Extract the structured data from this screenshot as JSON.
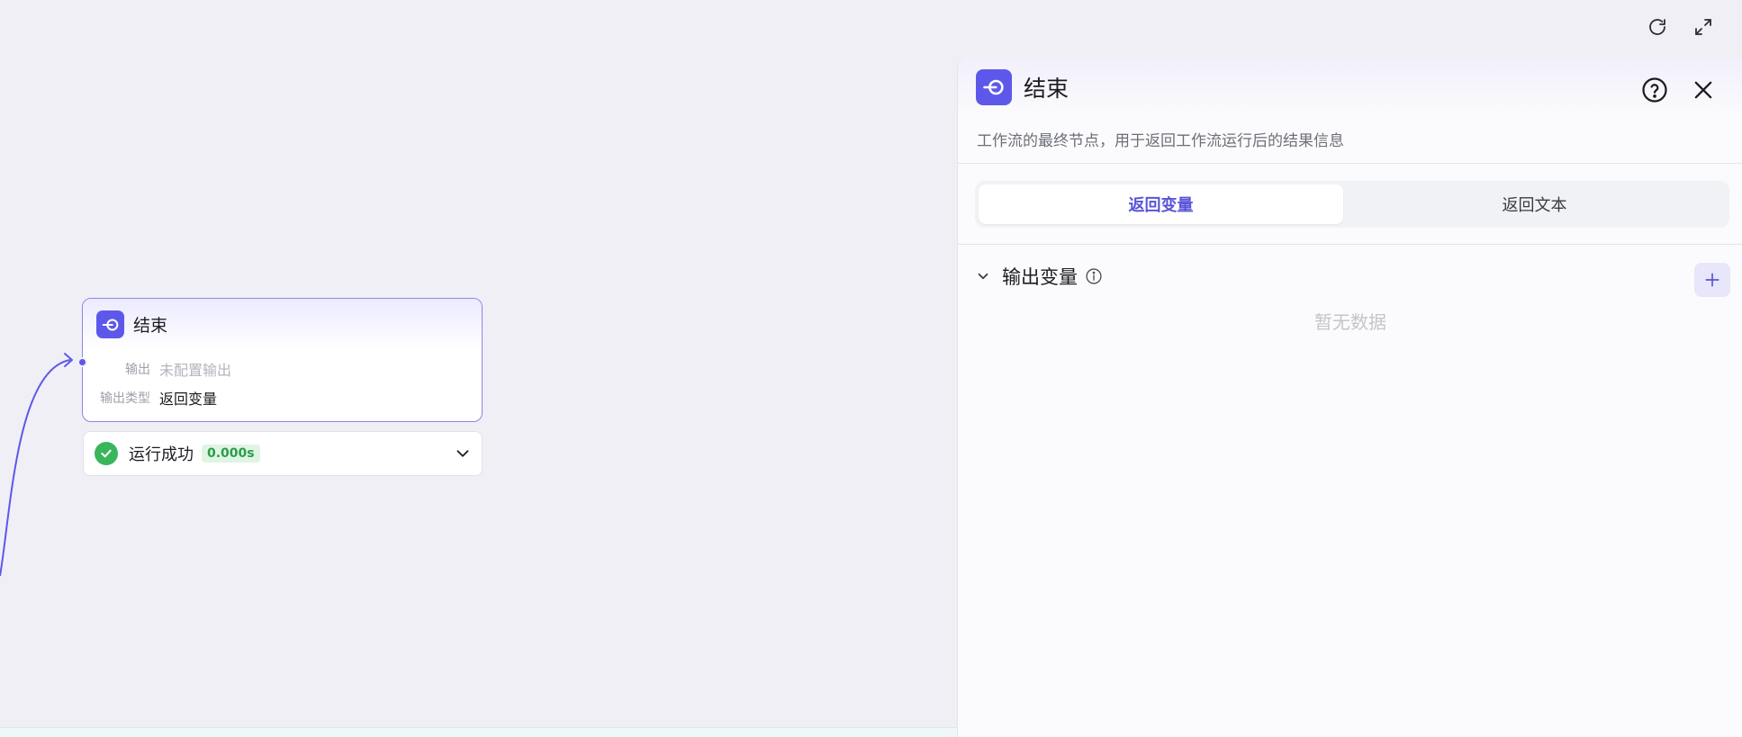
{
  "canvas": {
    "node": {
      "title": "结束",
      "rows": [
        {
          "label": "输出",
          "value": "未配置输出"
        },
        {
          "label": "输出类型",
          "value": "返回变量"
        }
      ]
    },
    "run_status": {
      "label": "运行成功",
      "time": "0.000s"
    }
  },
  "toolbar": {
    "icons": [
      "refresh-icon",
      "fullscreen-icon"
    ]
  },
  "panel": {
    "title": "结束",
    "description": "工作流的最终节点，用于返回工作流运行后的结果信息",
    "tabs": [
      {
        "label": "返回变量",
        "active": true
      },
      {
        "label": "返回文本",
        "active": false
      }
    ],
    "section": {
      "title": "输出变量",
      "empty_text": "暂无数据"
    }
  },
  "colors": {
    "accent": "#5e58ea",
    "success": "#3ab55b",
    "canvas_bg": "#f0eff5"
  }
}
